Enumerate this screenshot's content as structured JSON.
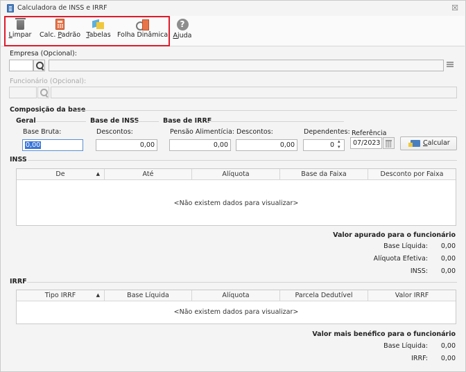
{
  "window": {
    "title": "Calculadora de INSS e IRRF",
    "close": "☒"
  },
  "toolbar": {
    "limpar": {
      "pre": "",
      "key": "L",
      "post": "impar"
    },
    "calc_padrao": {
      "pre": "Calc. ",
      "key": "P",
      "post": "adrão"
    },
    "tabelas": {
      "pre": "",
      "key": "T",
      "post": "abelas"
    },
    "folha": {
      "pre": "Folha Dinâmica",
      "key": "",
      "post": ""
    },
    "ajuda": {
      "pre": "",
      "key": "A",
      "post": "juda"
    },
    "help_glyph": "?"
  },
  "empresa": {
    "label": "Empresa (Opcional):",
    "code": "",
    "name": ""
  },
  "funcionario": {
    "label": "Funcionário (Opcional):",
    "code": "",
    "name": ""
  },
  "composicao": {
    "title": "Composição da base",
    "geral": "Geral",
    "base_inss": "Base de INSS",
    "base_irrf": "Base de IRRF",
    "base_bruta_label": "Base Bruta:",
    "base_bruta_value": "0,00",
    "descontos_inss_label": "Descontos:",
    "descontos_inss_value": "0,00",
    "pensao_label": "Pensão Alimentícia:",
    "pensao_value": "0,00",
    "descontos_irrf_label": "Descontos:",
    "descontos_irrf_value": "0,00",
    "dependentes_label": "Dependentes:",
    "dependentes_value": "0",
    "referencia_label": "Referência",
    "referencia_value": "07/2023",
    "calcular": {
      "key": "C",
      "post": "alcular"
    }
  },
  "inss": {
    "title": "INSS",
    "columns": [
      "De",
      "Até",
      "Alíquota",
      "Base da Faixa",
      "Desconto por Faixa"
    ],
    "sort_glyph": "▲",
    "empty": "<Não existem dados para visualizar>",
    "summary_title": "Valor apurado para o funcionário",
    "base_liquida_label": "Base Líquida:",
    "base_liquida_value": "0,00",
    "aliquota_label": "Alíquota Efetiva:",
    "aliquota_value": "0,00",
    "inss_label": "INSS:",
    "inss_value": "0,00"
  },
  "irrf": {
    "title": "IRRF",
    "columns": [
      "Tipo IRRF",
      "Base Líquida",
      "Alíquota",
      "Parcela Dedutível",
      "Valor IRRF"
    ],
    "sort_glyph": "▲",
    "empty": "<Não existem dados para visualizar>",
    "summary_title": "Valor mais benéfico para o funcionário",
    "base_liquida_label": "Base Líquida:",
    "base_liquida_value": "0,00",
    "irrf_label": "IRRF:",
    "irrf_value": "0,00"
  }
}
